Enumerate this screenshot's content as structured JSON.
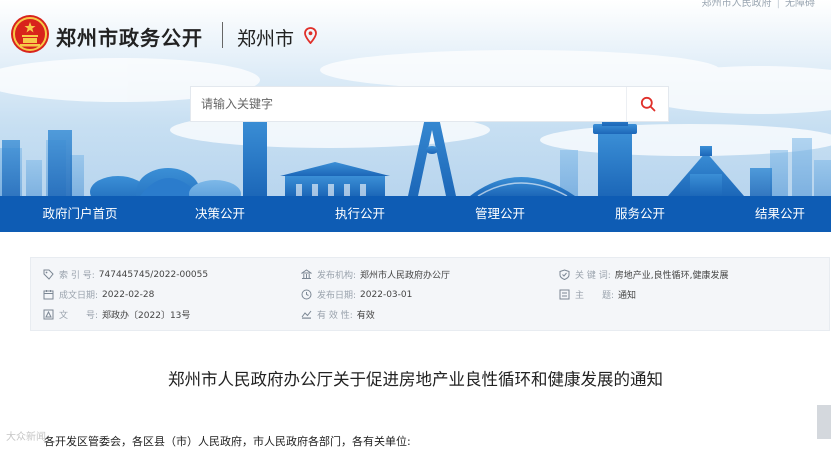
{
  "header": {
    "site_title": "郑州市政务公开",
    "city": "郑州市",
    "top_links": [
      "郑州市人民政府",
      "无障碍"
    ]
  },
  "search": {
    "placeholder": "请输入关键字"
  },
  "nav": {
    "items": [
      {
        "label": "政府门户首页"
      },
      {
        "label": "决策公开"
      },
      {
        "label": "执行公开"
      },
      {
        "label": "管理公开"
      },
      {
        "label": "服务公开"
      },
      {
        "label": "结果公开"
      }
    ]
  },
  "info": {
    "index_label": "索 引 号:",
    "index_value": "747445745/2022-00055",
    "org_label": "发布机构:",
    "org_value": "郑州市人民政府办公厅",
    "keyword_label": "关 键 词:",
    "keyword_value": "房地产业,良性循环,健康发展",
    "created_label": "成文日期:",
    "created_value": "2022-02-28",
    "published_label": "发布日期:",
    "published_value": "2022-03-01",
    "subject_label": "主　　题:",
    "subject_value": "通知",
    "docno_label": "文　　号:",
    "docno_value": "郑政办〔2022〕13号",
    "valid_label": "有 效 性:",
    "valid_value": "有效"
  },
  "article": {
    "title": "郑州市人民政府办公厅关于促进房地产业良性循环和健康发展的通知",
    "recipient": "各开发区管委会，各区县（市）人民政府，市人民政府各部门，各有关单位:"
  },
  "watermark": "大众新闻",
  "colors": {
    "nav_bg": "#0e5cb4",
    "accent_red": "#e0302a",
    "panel_bg": "#f4f6f9"
  }
}
